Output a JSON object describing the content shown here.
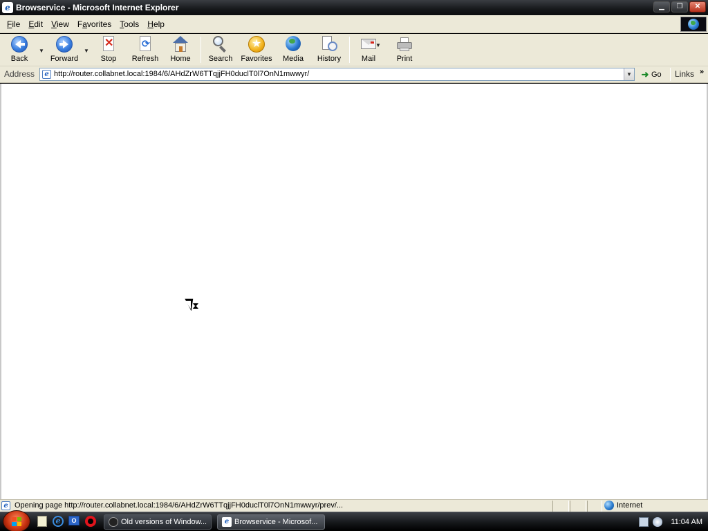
{
  "window": {
    "title": "Browservice - Microsoft Internet Explorer",
    "controls": [
      "minimize",
      "maximize",
      "close"
    ]
  },
  "menu": {
    "items": [
      {
        "label": "File",
        "accel": "F",
        "rest": "ile"
      },
      {
        "label": "Edit",
        "accel": "E",
        "rest": "dit"
      },
      {
        "label": "View",
        "accel": "V",
        "rest": "iew"
      },
      {
        "label": "Favorites",
        "accel": "a",
        "pre": "F",
        "rest": "vorites"
      },
      {
        "label": "Tools",
        "accel": "T",
        "rest": "ools"
      },
      {
        "label": "Help",
        "accel": "H",
        "rest": "elp"
      }
    ]
  },
  "toolbar": {
    "back": "Back",
    "forward": "Forward",
    "stop": "Stop",
    "refresh": "Refresh",
    "home": "Home",
    "search": "Search",
    "favorites": "Favorites",
    "media": "Media",
    "history": "History",
    "mail": "Mail",
    "print": "Print"
  },
  "address": {
    "label": "Address",
    "url": "http://router.collabnet.local:1984/6/AHdZrW6TTqjjFH0duclT0l7OnN1mwwyr/",
    "go": "Go",
    "links": "Links"
  },
  "statusbar": {
    "text": "Opening page http://router.collabnet.local:1984/6/AHdZrW6TTqjjFH0duclT0l7OnN1mwwyr/prev/...",
    "zone": "Internet"
  },
  "taskbar": {
    "items": [
      {
        "label": "Old versions of Window...",
        "active": false
      },
      {
        "label": "Browservice - Microsof...",
        "active": true
      }
    ],
    "clock": "11:04 AM"
  },
  "cursor": {
    "state": "busy"
  },
  "colors": {
    "chrome": "#ece9d8",
    "titlebar": "#16181b",
    "taskbar": "#15171a",
    "ie_blue": "#1f5fbf",
    "close_red": "#b7301b"
  }
}
